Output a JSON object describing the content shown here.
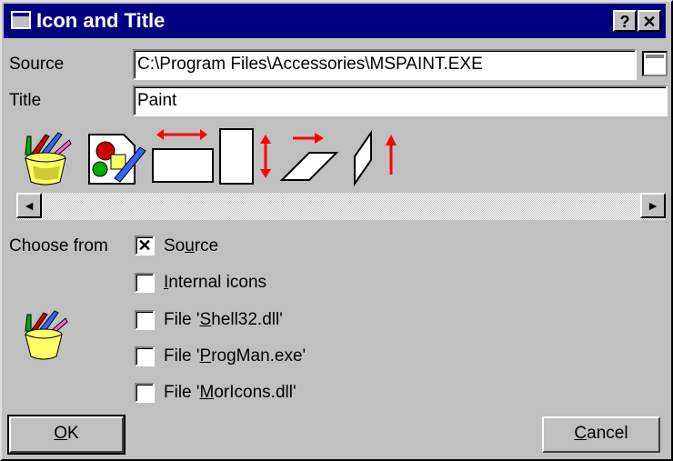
{
  "window": {
    "title": "Icon and Title",
    "help_button": "?",
    "close_button": "✕"
  },
  "source": {
    "label": "Source",
    "value": "C:\\Program Files\\Accessories\\MSPAINT.EXE"
  },
  "title_field": {
    "label": "Title",
    "value": "Paint"
  },
  "icons": [
    "paint-bucket-icon",
    "paint-document-icon",
    "rectangle-wide-icon",
    "rectangle-tall-icon",
    "parallelogram-icon",
    "slanted-panel-icon"
  ],
  "scroll": {
    "left": "◄",
    "right": "►"
  },
  "choose_from": {
    "label": "Choose from",
    "options": [
      {
        "pre": "So",
        "u": "u",
        "post": "rce",
        "checked": true
      },
      {
        "pre": "",
        "u": "I",
        "post": "nternal icons",
        "checked": false
      },
      {
        "pre": "File '",
        "u": "S",
        "post": "hell32.dll'",
        "checked": false
      },
      {
        "pre": "File '",
        "u": "P",
        "post": "rogMan.exe'",
        "checked": false
      },
      {
        "pre": "File '",
        "u": "M",
        "post": "orIcons.dll'",
        "checked": false
      }
    ]
  },
  "buttons": {
    "ok_u": "O",
    "ok_rest": "K",
    "cancel_u": "C",
    "cancel_rest": "ancel"
  },
  "colors": {
    "titlebar": "#000080",
    "face": "#c0c0c0",
    "arrow": "#ff0000"
  }
}
